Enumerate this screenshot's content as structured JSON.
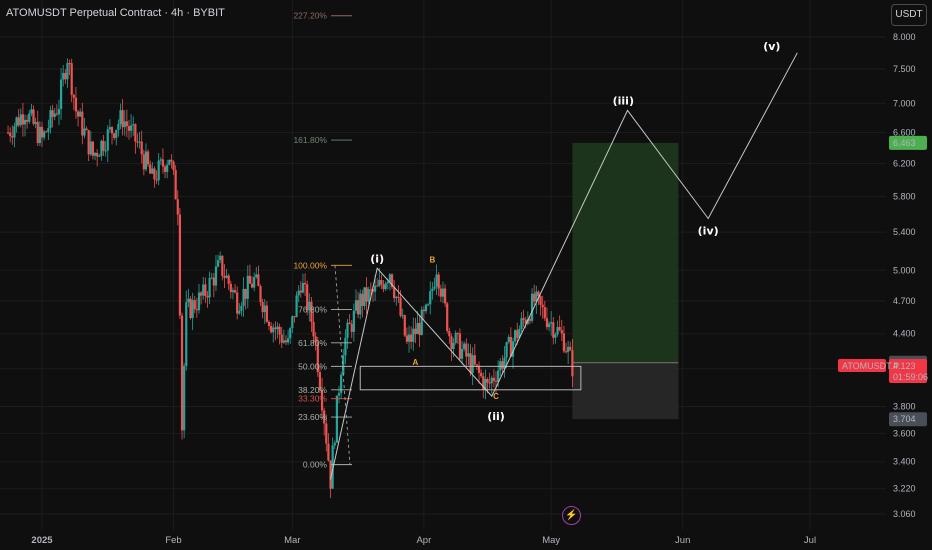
{
  "header": {
    "title": "ATOMUSDT Perpetual Contract · 4h · BYBIT",
    "currency_button": "USDT"
  },
  "colors": {
    "background": "#0f0f0f",
    "up": "#26a69a",
    "down": "#ef5350",
    "green_zone": "#1e3a1e",
    "fib": "#a9b4a7"
  },
  "chart_data": {
    "type": "candlestick",
    "symbol": "ATOMUSDT.P",
    "timeframe": "4h",
    "exchange": "BYBIT",
    "y_scale": "log",
    "ylim": [
      3.0,
      8.35
    ],
    "y_ticks": [
      "8.000",
      "7.500",
      "7.000",
      "6.600",
      "6.200",
      "5.800",
      "5.400",
      "5.000",
      "4.700",
      "4.400",
      "4.100",
      "3.800",
      "3.600",
      "3.400",
      "3.220",
      "3.060"
    ],
    "x_ticks": [
      "2025",
      "Feb",
      "Mar",
      "Apr",
      "May",
      "Jun",
      "Jul"
    ],
    "price_path": [
      {
        "date": "2024-12-24",
        "price": 6.6
      },
      {
        "date": "2024-12-28",
        "price": 6.9
      },
      {
        "date": "2025-01-01",
        "price": 6.5
      },
      {
        "date": "2025-01-05",
        "price": 7.0
      },
      {
        "date": "2025-01-07",
        "price": 7.7
      },
      {
        "date": "2025-01-09",
        "price": 6.9
      },
      {
        "date": "2025-01-13",
        "price": 6.3
      },
      {
        "date": "2025-01-17",
        "price": 6.6
      },
      {
        "date": "2025-01-20",
        "price": 6.8
      },
      {
        "date": "2025-01-24",
        "price": 6.4
      },
      {
        "date": "2025-01-27",
        "price": 6.0
      },
      {
        "date": "2025-01-31",
        "price": 6.3
      },
      {
        "date": "2025-02-02",
        "price": 5.7
      },
      {
        "date": "2025-02-03",
        "price": 3.65
      },
      {
        "date": "2025-02-04",
        "price": 4.6
      },
      {
        "date": "2025-02-08",
        "price": 4.75
      },
      {
        "date": "2025-02-12",
        "price": 5.05
      },
      {
        "date": "2025-02-16",
        "price": 4.7
      },
      {
        "date": "2025-02-20",
        "price": 4.9
      },
      {
        "date": "2025-02-24",
        "price": 4.5
      },
      {
        "date": "2025-02-28",
        "price": 4.3
      },
      {
        "date": "2025-03-03",
        "price": 4.9
      },
      {
        "date": "2025-03-06",
        "price": 4.45
      },
      {
        "date": "2025-03-10",
        "price": 3.28
      },
      {
        "date": "2025-03-13",
        "price": 4.3
      },
      {
        "date": "2025-03-17",
        "price": 4.7
      },
      {
        "date": "2025-03-21",
        "price": 4.8
      },
      {
        "date": "2025-03-24",
        "price": 5.0
      },
      {
        "date": "2025-03-28",
        "price": 4.3
      },
      {
        "date": "2025-04-02",
        "price": 4.6
      },
      {
        "date": "2025-04-04",
        "price": 5.05
      },
      {
        "date": "2025-04-07",
        "price": 4.4
      },
      {
        "date": "2025-04-11",
        "price": 4.2
      },
      {
        "date": "2025-04-16",
        "price": 3.95
      },
      {
        "date": "2025-04-20",
        "price": 4.2
      },
      {
        "date": "2025-04-25",
        "price": 4.55
      },
      {
        "date": "2025-04-27",
        "price": 4.7
      },
      {
        "date": "2025-05-01",
        "price": 4.5
      },
      {
        "date": "2025-05-04",
        "price": 4.35
      },
      {
        "date": "2025-05-06",
        "price": 4.12
      }
    ],
    "price_labels": [
      {
        "label": "6.463",
        "value": 6.463,
        "color": "#4caf50"
      },
      {
        "label": "4.150",
        "value": 4.15,
        "color": "#4a4e57"
      },
      {
        "label": "4.123",
        "value": 4.123,
        "color": "#f23645",
        "countdown": "01:59:06",
        "symbol": "ATOMUSDT.P"
      },
      {
        "label": "3.704",
        "value": 3.704,
        "color": "#4a4e57"
      }
    ],
    "fib_levels": [
      {
        "label": "227.20%",
        "value": 8.35,
        "color": "#8a6d63"
      },
      {
        "label": "161.80%",
        "value": 6.5,
        "color": "#6d8a70"
      },
      {
        "label": "100.00%",
        "value": 5.05,
        "color": "#e8a33d"
      },
      {
        "label": "76.80%",
        "value": 4.62,
        "color": "#a9b4a7"
      },
      {
        "label": "61.80%",
        "value": 4.32,
        "color": "#a9b4a7"
      },
      {
        "label": "50.00%",
        "value": 4.12,
        "color": "#a9b4a7"
      },
      {
        "label": "38.20%",
        "value": 3.93,
        "color": "#a9b4a7"
      },
      {
        "label": "33.30%",
        "value": 3.86,
        "color": "#d9534f"
      },
      {
        "label": "23.60%",
        "value": 3.72,
        "color": "#a9b4a7"
      },
      {
        "label": "0.00%",
        "value": 3.38,
        "color": "#a9b4a7"
      }
    ],
    "wave_labels": [
      {
        "label": "(i)",
        "date": "2025-03-21",
        "value": 5.02
      },
      {
        "label": "(ii)",
        "date": "2025-04-18",
        "value": 3.82
      },
      {
        "label": "(iii)",
        "date": "2025-05-18",
        "value": 6.9
      },
      {
        "label": "(iv)",
        "date": "2025-06-07",
        "value": 5.55
      },
      {
        "label": "(v)",
        "date": "2025-06-22",
        "value": 7.7
      }
    ],
    "abc_labels": [
      {
        "label": "A",
        "date": "2025-03-30",
        "value": 4.2
      },
      {
        "label": "B",
        "date": "2025-04-03",
        "value": 5.0
      },
      {
        "label": "C",
        "date": "2025-04-18",
        "value": 3.92
      }
    ],
    "projection_path": [
      {
        "date": "2025-03-10",
        "value": 3.28
      },
      {
        "date": "2025-03-21",
        "value": 5.02
      },
      {
        "date": "2025-04-17",
        "value": 3.88
      },
      {
        "date": "2025-05-19",
        "value": 6.9
      },
      {
        "date": "2025-06-07",
        "value": 5.55
      },
      {
        "date": "2025-06-28",
        "value": 7.75
      }
    ],
    "support_box": {
      "date_from": "2025-03-17",
      "date_to": "2025-05-08",
      "low": 3.93,
      "high": 4.12
    },
    "target_zone": {
      "date_from": "2025-05-06",
      "date_to": "2025-05-31",
      "low": 4.15,
      "high": 6.463
    },
    "stop_zone": {
      "date_from": "2025-05-06",
      "date_to": "2025-05-31",
      "low": 3.704,
      "high": 4.15
    }
  }
}
